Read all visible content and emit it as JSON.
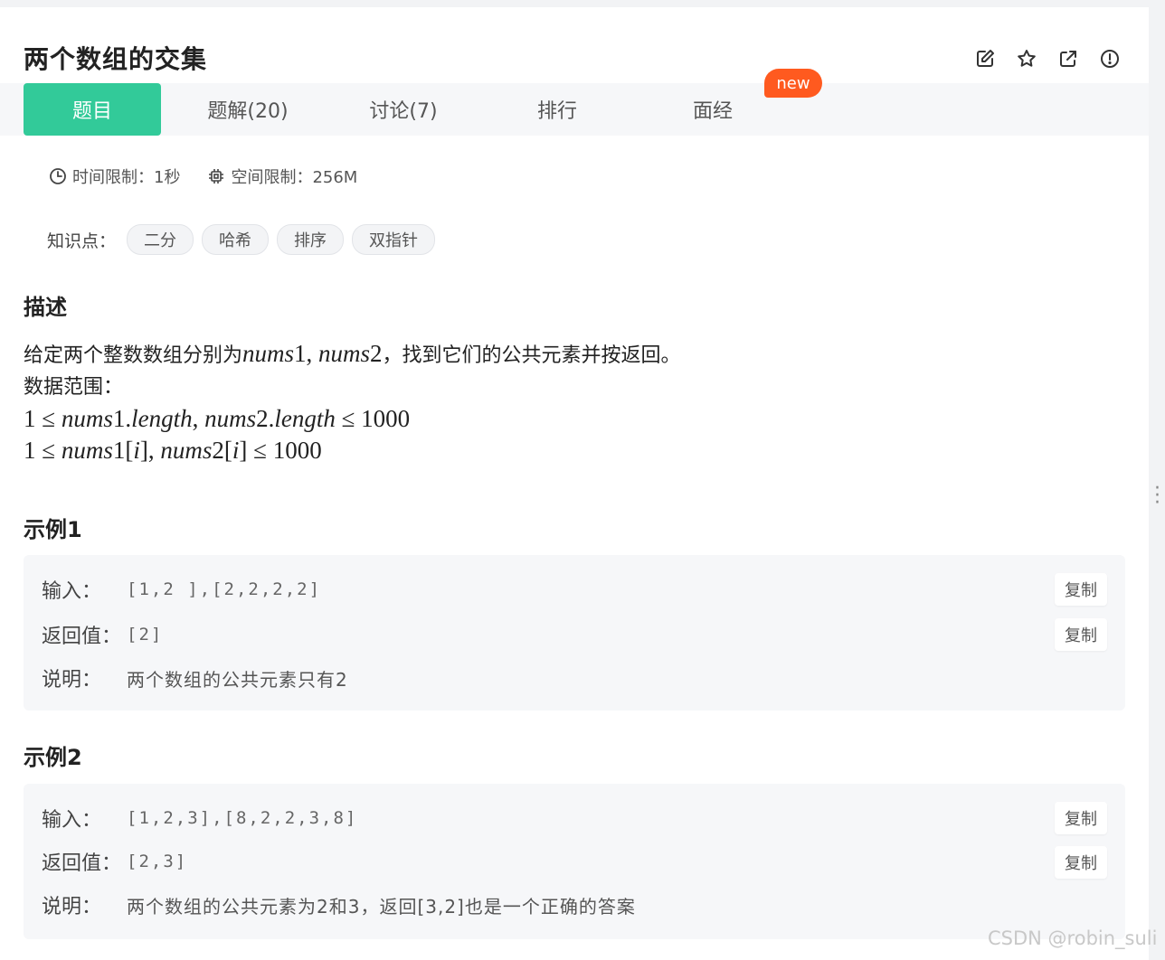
{
  "problem": {
    "title": "两个数组的交集"
  },
  "header_icons": [
    "edit-icon",
    "star-icon",
    "share-icon",
    "report-icon"
  ],
  "tabs": [
    {
      "label": "题目",
      "active": true
    },
    {
      "label": "题解(20)"
    },
    {
      "label": "讨论(7)"
    },
    {
      "label": "排行"
    },
    {
      "label": "面经"
    }
  ],
  "new_badge": "new",
  "limits": {
    "time": "时间限制：1秒",
    "space": "空间限制：256M"
  },
  "knowledge": {
    "label": "知识点：",
    "tags": [
      "二分",
      "哈希",
      "排序",
      "双指针"
    ]
  },
  "description": {
    "heading": "描述",
    "text_before": "给定两个整数数组分别为",
    "text_after": "，找到它们的公共元素并按返回。",
    "range_label": "数据范围："
  },
  "examples": [
    {
      "heading": "示例1",
      "input_label": "输入：",
      "input": "[1,2 ],[2,2,2,2]",
      "output_label": "返回值：",
      "output": "[2]",
      "explain_label": "说明：",
      "explain": "两个数组的公共元素只有2",
      "copy": "复制"
    },
    {
      "heading": "示例2",
      "input_label": "输入：",
      "input": "[1,2,3],[8,2,2,3,8]",
      "output_label": "返回值：",
      "output": "[2,3]",
      "explain_label": "说明：",
      "explain": "两个数组的公共元素为2和3，返回[3,2]也是一个正确的答案",
      "copy": "复制"
    }
  ],
  "watermark": "CSDN @robin_suli",
  "colors": {
    "accent": "#32ca99",
    "badge": "#ff5a1f"
  }
}
